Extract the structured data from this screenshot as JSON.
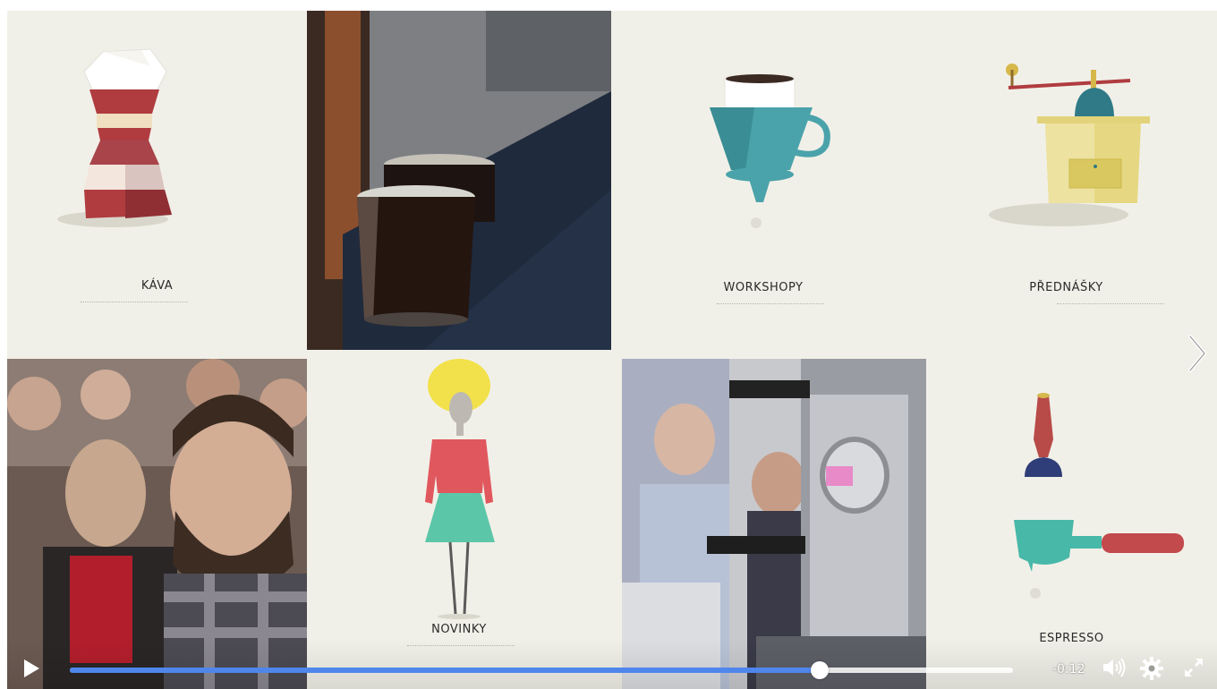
{
  "tiles": {
    "kava": "KÁVA",
    "workshopy": "WORKSHOPY",
    "prednasky": "PŘEDNÁŠKY",
    "novinky": "NOVINKY",
    "espresso": "ESPRESSO"
  },
  "player": {
    "progress_fraction": 0.795,
    "time_remaining": "-0:12"
  },
  "icons": {
    "play": "play-icon",
    "volume": "volume-icon",
    "settings": "gear-icon",
    "fullscreen": "fullscreen-icon",
    "next": "chevron-right-icon"
  },
  "colors": {
    "progress_fill": "#4f86ec",
    "tile_background": "#f1f0e8"
  }
}
